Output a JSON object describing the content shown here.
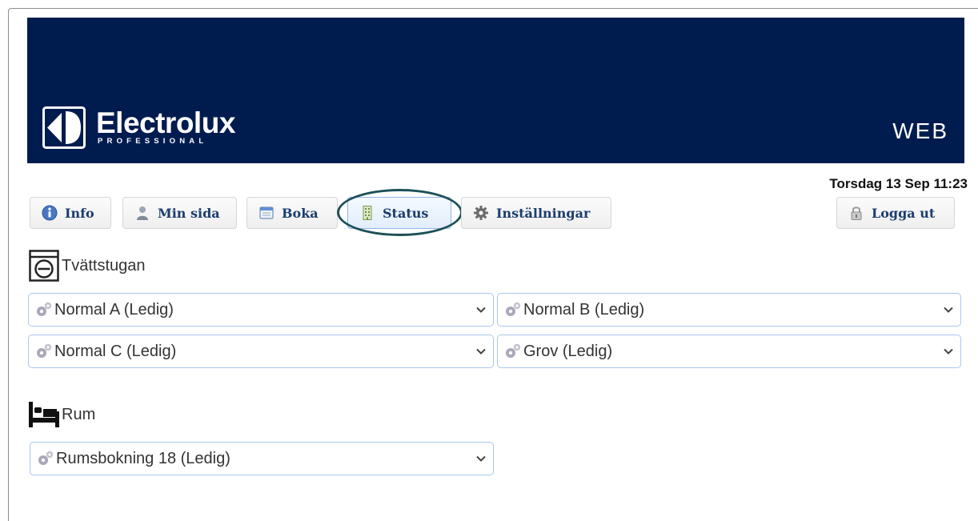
{
  "brand": {
    "logo_word": "Electrolux",
    "logo_sub": "PROFESSIONAL",
    "product": "WEB"
  },
  "datetime": "Torsdag 13 Sep 11:23",
  "nav": {
    "info": "Info",
    "min_sida": "Min sida",
    "boka": "Boka",
    "status": "Status",
    "installningar": "Inställningar",
    "logga_ut": "Logga ut",
    "active": "Status"
  },
  "sections": {
    "laundry": {
      "title": "Tvättstugan",
      "icon": "washing-machine-icon",
      "machines": [
        {
          "label": "Normal A (Ledig)"
        },
        {
          "label": "Normal B (Ledig)"
        },
        {
          "label": "Normal C (Ledig)"
        },
        {
          "label": "Grov (Ledig)"
        }
      ]
    },
    "rooms": {
      "title": "Rum",
      "icon": "bed-icon",
      "items": [
        {
          "label": "Rumsbokning 18 (Ledig)"
        }
      ]
    }
  },
  "colors": {
    "banner": "#001c4f",
    "nav_text": "#1b3d6e",
    "select_border": "#a9c7ec",
    "highlight_ring": "#1d5059"
  }
}
